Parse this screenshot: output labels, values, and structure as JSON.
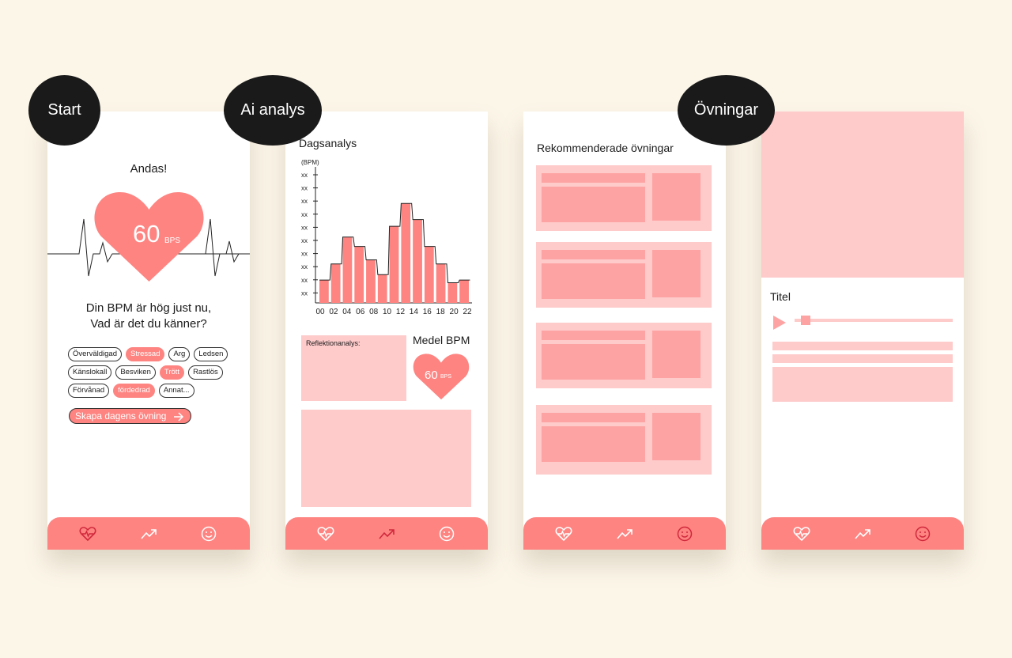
{
  "labels": {
    "start": "Start",
    "ai_analys": "Ai analys",
    "ovningar": "Övningar"
  },
  "start_screen": {
    "title": "Andas!",
    "bpm": "60",
    "bps_unit": "BPS",
    "question_line1": "Din BPM är hög just nu,",
    "question_line2": "Vad är det du känner?",
    "chips": [
      [
        {
          "label": "Överväldigad",
          "on": false
        },
        {
          "label": "Stressad",
          "on": true
        },
        {
          "label": "Arg",
          "on": false
        },
        {
          "label": "Ledsen",
          "on": false
        }
      ],
      [
        {
          "label": "Känslokall",
          "on": false
        },
        {
          "label": "Besviken",
          "on": false
        },
        {
          "label": "Trött",
          "on": true
        },
        {
          "label": "Rastlös",
          "on": false
        }
      ],
      [
        {
          "label": "Förvånad",
          "on": false
        },
        {
          "label": "fördedrad",
          "on": true
        },
        {
          "label": "Annat...",
          "on": false
        }
      ]
    ],
    "cta": "Skapa dagens övning"
  },
  "analys_screen": {
    "title": "Dagsanalys",
    "reflection_label": "Reflektionanalys:",
    "medel_title": "Medel BPM",
    "medel_bpm": "60",
    "medel_unit": "BPS"
  },
  "ovningar_screen": {
    "title": "Rekommenderade övningar",
    "card_count": 4
  },
  "player_screen": {
    "title": "Titel"
  },
  "nav": {
    "items": [
      "heart-pulse-icon",
      "trending-icon",
      "smiley-icon"
    ]
  },
  "colors": {
    "accent": "#fe8481",
    "accent_dark": "#d0283b",
    "placeholder": "#fecaca",
    "placeholder_dark": "#fea3a3",
    "background": "#fcf6e9"
  },
  "chart_data": {
    "type": "bar",
    "title": "Dagsanalys",
    "ylabel": "(BPM)",
    "y_tick_labels": [
      "xx",
      "xx",
      "xx",
      "xx",
      "xx",
      "xx",
      "xx",
      "xx",
      "xx",
      "xx"
    ],
    "x_tick_labels": [
      "00",
      "02",
      "04",
      "06",
      "08",
      "10",
      "12",
      "14",
      "16",
      "18",
      "20",
      "22"
    ],
    "ylim": [
      0,
      10
    ],
    "values": [
      1.7,
      2.9,
      4.9,
      4.2,
      3.2,
      2.1,
      5.7,
      7.4,
      6.2,
      4.2,
      2.9,
      1.5,
      1.7
    ]
  }
}
